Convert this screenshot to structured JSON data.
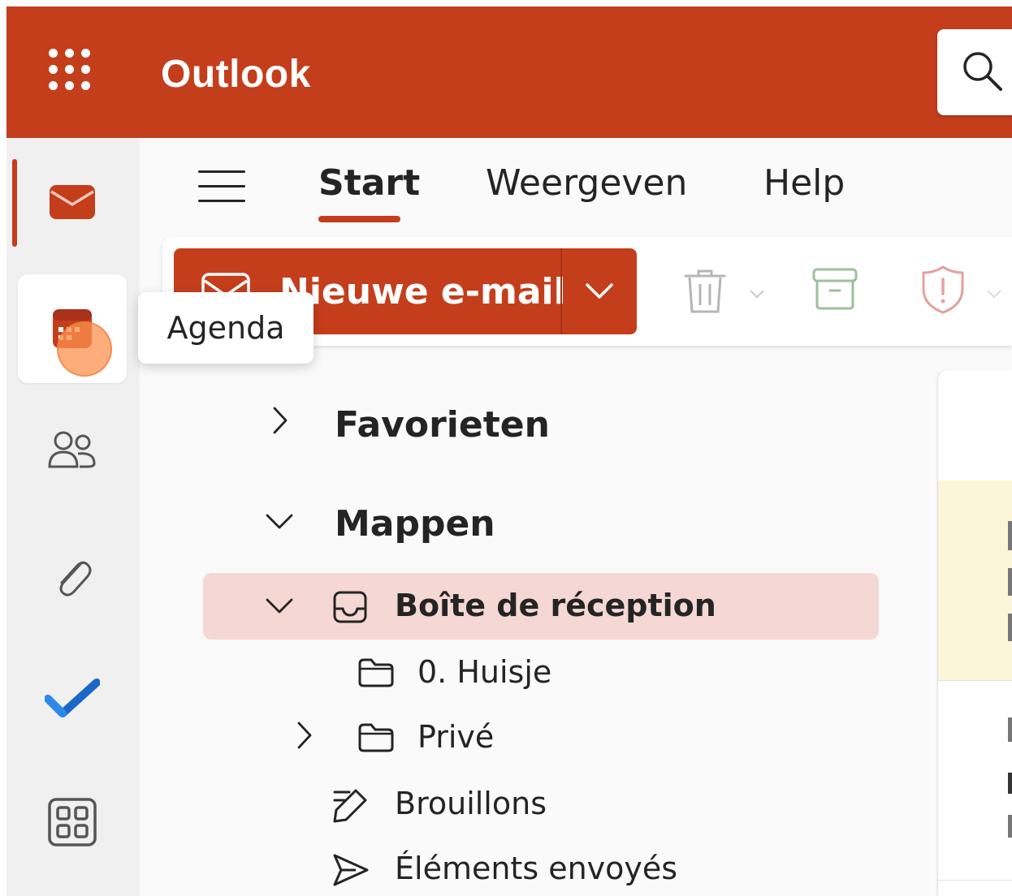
{
  "app": {
    "title": "Outlook",
    "accent_color": "#c43e1c"
  },
  "header": {
    "search_icon": "search-icon",
    "waffle_icon": "app-launcher-icon"
  },
  "rail": {
    "items": [
      {
        "name": "mail",
        "icon": "mail-icon",
        "active": true
      },
      {
        "name": "calendar",
        "icon": "calendar-icon",
        "hovered": true
      },
      {
        "name": "people",
        "icon": "people-icon"
      },
      {
        "name": "files",
        "icon": "paperclip-icon"
      },
      {
        "name": "todo",
        "icon": "todo-check-icon"
      },
      {
        "name": "apps",
        "icon": "apps-grid-icon"
      }
    ],
    "tooltip": "Agenda"
  },
  "tabs": [
    {
      "label": "Start",
      "active": true
    },
    {
      "label": "Weergeven"
    },
    {
      "label": "Help"
    }
  ],
  "ribbon": {
    "new_mail_label": "Nieuwe e-mail",
    "icons": [
      "delete-icon",
      "archive-icon",
      "report-icon"
    ]
  },
  "folders": {
    "favorites_label": "Favorieten",
    "folders_label": "Mappen",
    "inbox_label": "Boîte de réception",
    "items": [
      {
        "label": "0. Huisje"
      },
      {
        "label": "Privé"
      },
      {
        "label": "Brouillons"
      },
      {
        "label": "Éléments envoyés"
      }
    ]
  }
}
